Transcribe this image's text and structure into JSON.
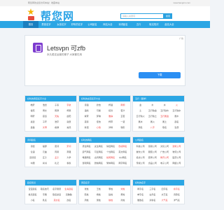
{
  "top_strip": {
    "left": "帮您网欢迎您访问本站！收藏本站",
    "right": "www.bangnin.com"
  },
  "header": {
    "logo_text": "帮您网",
    "logo_url": "www.bangnin.com"
  },
  "search": {
    "placeholder": "请输入关键词",
    "button_label": "搜索"
  },
  "nav": {
    "items": [
      {
        "label": "首页",
        "active": true
      },
      {
        "label": "男孩名字",
        "active": false
      },
      {
        "label": "女孩名字",
        "active": false
      },
      {
        "label": "好听的名字",
        "active": false
      },
      {
        "label": "公司起名",
        "active": false
      },
      {
        "label": "网名大全",
        "active": false
      },
      {
        "label": "诗词起名",
        "active": false
      },
      {
        "label": "五行",
        "active": false
      },
      {
        "label": "取名知识",
        "active": false
      },
      {
        "label": "起名大全",
        "active": false
      }
    ]
  },
  "ad": {
    "title": "Letsvpn 可zfb",
    "subtitle": "永久稳定运营的梯子 大家都在用",
    "button": "下载",
    "tag": "广告"
  },
  "panels": [
    {
      "title": "好听的男孩名字大全",
      "items": [
        "皓轩",
        "浩然",
        "子墨",
        "宇航",
        "俊熙",
        "博文",
        "雨泽",
        "梓豪",
        "明轩",
        "思远",
        "天佑",
        "晨阳",
        "嘉懿",
        "子轩",
        "浩宇",
        "奕辰",
        "鑫磊",
        "文博",
        "睿渊",
        "昊然"
      ]
    },
    {
      "title": "好听的女孩名字大全",
      "items": [
        "诗涵",
        "欣怡",
        "梓涵",
        "雨桐",
        "语嫣",
        "可馨",
        "婉清",
        "若汐",
        "紫萱",
        "梦琪",
        "雅静",
        "芷若",
        "思彤",
        "佳怡",
        "梓萱",
        "一诺",
        "依诺",
        "心怡",
        "沐晴",
        "悦彤"
      ]
    },
    {
      "title": "五行（国学）",
      "items": [
        "金",
        "木",
        "水",
        "火",
        "土",
        "五行缺金",
        "五行缺木",
        "五行缺水",
        "五行缺火",
        "五行缺土",
        "五行属金",
        "属木",
        "属水",
        "属火",
        "属土",
        "起名",
        "测名",
        "八字",
        "取名",
        "生辰"
      ]
    },
    {
      "title": "诗词起名",
      "items": [
        "诗经",
        "楚辞",
        "唐诗",
        "宋词",
        "论语",
        "元曲",
        "周易",
        "离骚",
        "道德经",
        "庄子",
        "孟子",
        "大学",
        "中庸",
        "尚书",
        "礼记",
        "春秋"
      ]
    },
    {
      "title": "好听的网名",
      "items": [
        "男生网名",
        "女生网名",
        "情侣网名",
        "伤感网名",
        "霸气网名",
        "可爱网名",
        "个性网名",
        "英文网名",
        "唯美网名",
        "古风网名",
        "搞笑网名",
        "QQ网名",
        "游戏网名",
        "微信网名",
        "繁体网名",
        "两字网名"
      ]
    },
    {
      "title": "公司起名",
      "items": [
        "科技公司",
        "贸易公司",
        "文化公司",
        "建筑公司",
        "餐饮公司",
        "服装公司",
        "广告公司",
        "物流公司",
        "投资公司",
        "装饰公司",
        "教育公司",
        "医药公司",
        "传媒公司",
        "食品公司",
        "电子公司",
        "网络公司"
      ]
    },
    {
      "title": "起名知识",
      "items": [
        "宝宝起名",
        "取名技巧",
        "名字寓意",
        "生肖起名",
        "姓氏起名",
        "字典",
        "取名禁忌",
        "双胞胎",
        "小名",
        "乳名",
        "英文名",
        "改名"
      ]
    },
    {
      "title": "男孩名字",
      "items": [
        "张姓",
        "王姓",
        "李姓",
        "刘姓",
        "陈姓",
        "杨姓",
        "赵姓",
        "黄姓",
        "周姓",
        "吴姓",
        "徐姓",
        "孙姓"
      ]
    },
    {
      "title": "好听的名字",
      "items": [
        "两字名",
        "三字名",
        "四字名",
        "叠字名",
        "单字名",
        "古风名",
        "文艺名",
        "诗意名",
        "雅致名",
        "清新名",
        "大气名",
        "洋气名"
      ]
    }
  ]
}
